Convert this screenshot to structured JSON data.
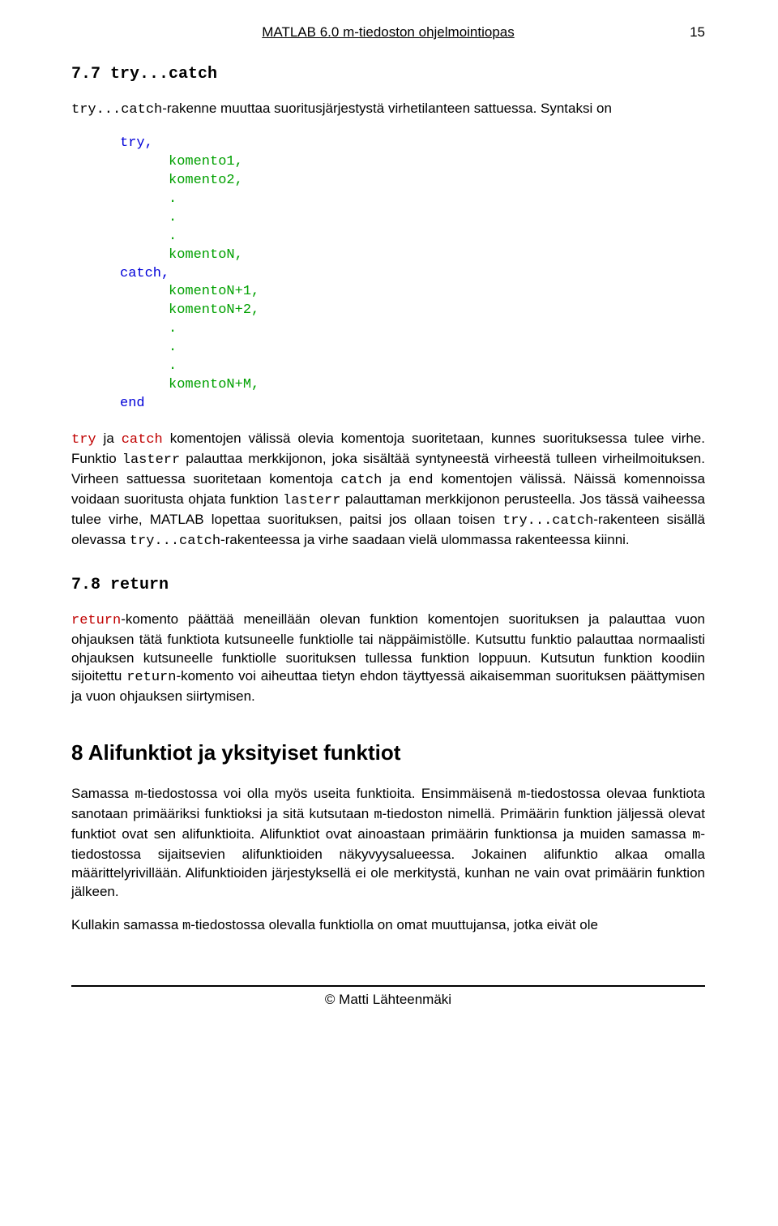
{
  "header": {
    "title": "MATLAB 6.0 m-tiedoston ohjelmointiopas",
    "page_number": "15"
  },
  "s77": {
    "heading": "7.7 try...catch",
    "p1_a": "try...catch",
    "p1_b": "-rakenne muuttaa suoritusjärjestystä virhetilanteen sattuessa. Syntaksi on",
    "code": {
      "l1": "try,",
      "l2": "komento1,",
      "l3": "komento2,",
      "l4": ".",
      "l5": ".",
      "l6": ".",
      "l7": "komentoN,",
      "l8": "catch,",
      "l9": "komentoN+1,",
      "l10": "komentoN+2,",
      "l11": ".",
      "l12": ".",
      "l13": ".",
      "l14": "komentoN+M,",
      "l15": "end"
    },
    "p2_a": "try",
    "p2_b": " ja ",
    "p2_c": "catch",
    "p2_d": " komentojen välissä olevia komentoja suoritetaan, kunnes suorituksessa tulee virhe. Funktio ",
    "p2_e": "lasterr",
    "p2_f": " palauttaa merkkijonon, joka sisältää syntyneestä virheestä tulleen virheilmoituksen. Virheen sattuessa suoritetaan komentoja ",
    "p2_g": "catch",
    "p2_h": " ja ",
    "p2_i": "end",
    "p2_j": " komentojen välissä. Näissä komennoissa voidaan suoritusta ohjata funktion ",
    "p2_k": "lasterr",
    "p2_l": " palauttaman merkkijonon perusteella. Jos tässä vaiheessa tulee virhe, MATLAB lopettaa suorituksen, paitsi jos ollaan toisen ",
    "p2_m": "try...catch",
    "p2_n": "-rakenteen sisällä olevassa ",
    "p2_o": "try...catch",
    "p2_p": "-rakenteessa ja virhe saadaan vielä ulommassa rakenteessa kiinni."
  },
  "s78": {
    "heading": "7.8 return",
    "p1_a": "return",
    "p1_b": "-komento päättää meneillään olevan funktion komentojen suorituksen ja palauttaa vuon ohjauksen tätä funktiota kutsuneelle funktiolle tai näppäimistölle. Kutsuttu funktio palauttaa normaalisti ohjauksen kutsuneelle funktiolle suorituksen tullessa funktion loppuun. Kutsutun funktion koodiin sijoitettu ",
    "p1_c": "return",
    "p1_d": "-komento voi aiheuttaa tietyn ehdon täyttyessä aikaisemman suorituksen päättymisen ja vuon ohjauksen siirtymisen."
  },
  "s8": {
    "heading": "8  Alifunktiot ja yksityiset funktiot",
    "p1_a": "Samassa ",
    "p1_b": "m",
    "p1_c": "-tiedostossa voi olla myös useita funktioita. Ensimmäisenä ",
    "p1_d": "m",
    "p1_e": "-tiedostossa olevaa funktiota sanotaan primääriksi funktioksi ja sitä kutsutaan ",
    "p1_f": "m",
    "p1_g": "-tiedoston nimellä. Primäärin funktion jäljessä olevat funktiot ovat sen alifunktioita. Alifunktiot ovat ainoastaan primäärin funktionsa ja muiden samassa ",
    "p1_h": "m",
    "p1_i": "-tiedostossa sijaitsevien alifunktioiden näkyvyysalueessa. Jokainen alifunktio alkaa omalla määrittelyrivillään. Alifunktioiden järjestyksellä ei ole merkitystä, kunhan ne vain ovat primäärin funktion jälkeen.",
    "p2_a": "Kullakin samassa ",
    "p2_b": "m",
    "p2_c": "-tiedostossa olevalla funktiolla on omat muuttujansa, jotka eivät ole"
  },
  "footer": {
    "text": "© Matti Lähteenmäki"
  }
}
